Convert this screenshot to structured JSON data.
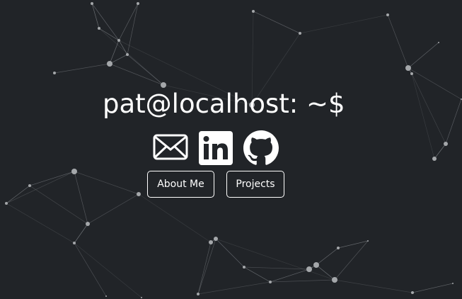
{
  "terminal_prompt": "pat@localhost: ~$",
  "social_links": [
    {
      "icon": "mail-icon"
    },
    {
      "icon": "linkedin-icon"
    },
    {
      "icon": "github-icon"
    }
  ],
  "nav_buttons": {
    "about_label": "About Me",
    "projects_label": "Projects"
  },
  "colors": {
    "background": "#212428",
    "foreground": "#ffffff",
    "particle": "#9a9ea3"
  }
}
